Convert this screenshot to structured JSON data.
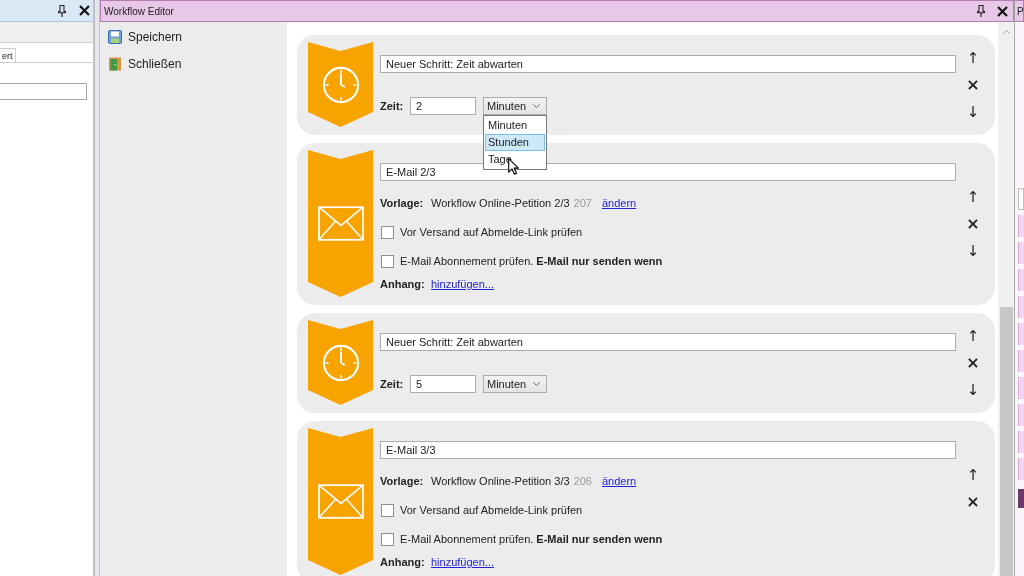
{
  "left_panel": {
    "tabs": [
      {
        "label": "ert",
        "selected": true
      }
    ]
  },
  "editor": {
    "title": "Workflow Editor",
    "sidebar": [
      {
        "kind": "save",
        "label": "Speichern"
      },
      {
        "kind": "close",
        "label": "Schließen"
      }
    ],
    "steps": [
      {
        "kind": "wait",
        "title": "Neuer Schritt: Zeit abwarten",
        "time_label": "Zeit:",
        "time_value": "2",
        "unit": "Minuten",
        "dropdown": {
          "open": true,
          "options": [
            {
              "label": "Minuten",
              "selected": false
            },
            {
              "label": "Stunden",
              "selected": true
            },
            {
              "label": "Tage",
              "selected": false
            }
          ]
        },
        "actions": [
          {
            "kind": "up",
            "symbol": "↑"
          },
          {
            "kind": "remove",
            "symbol": "×"
          },
          {
            "kind": "down",
            "symbol": "↓"
          }
        ]
      },
      {
        "kind": "email",
        "title": "E-Mail 2/3",
        "template_label": "Vorlage:",
        "template_name": "Workflow Online-Petition 2/3",
        "template_number": "207",
        "template_link": "ändern",
        "checks": [
          {
            "label": "Vor Versand auf Abmelde-Link prüfen",
            "checked": false
          },
          {
            "label": "E-Mail Abonnement prüfen. **E-Mail nur senden wenn**",
            "checked": false
          }
        ],
        "attachment_label": "Anhang:",
        "attachment_link": "hinzufügen...",
        "actions": [
          {
            "kind": "up",
            "symbol": "↑"
          },
          {
            "kind": "remove",
            "symbol": "×"
          },
          {
            "kind": "down",
            "symbol": "↓"
          }
        ]
      },
      {
        "kind": "wait",
        "title": "Neuer Schritt: Zeit abwarten",
        "time_label": "Zeit:",
        "time_value": "5",
        "unit": "Minuten",
        "actions": [
          {
            "kind": "up",
            "symbol": "↑"
          },
          {
            "kind": "remove",
            "symbol": "×"
          },
          {
            "kind": "down",
            "symbol": "↓"
          }
        ]
      },
      {
        "kind": "email",
        "title": "E-Mail 3/3",
        "template_label": "Vorlage:",
        "template_name": "Workflow Online-Petition 3/3",
        "template_number": "206",
        "template_link": "ändern",
        "checks": [
          {
            "label": "Vor Versand auf Abmelde-Link prüfen",
            "checked": false
          },
          {
            "label": "E-Mail Abonnement prüfen. **E-Mail nur senden wenn**",
            "checked": false
          }
        ],
        "attachment_label": "Anhang:",
        "attachment_link": "hinzufügen...",
        "actions": [
          {
            "kind": "up",
            "symbol": "↑"
          },
          {
            "kind": "remove",
            "symbol": "×"
          }
        ]
      }
    ]
  },
  "right_panel": {
    "title": "P"
  }
}
